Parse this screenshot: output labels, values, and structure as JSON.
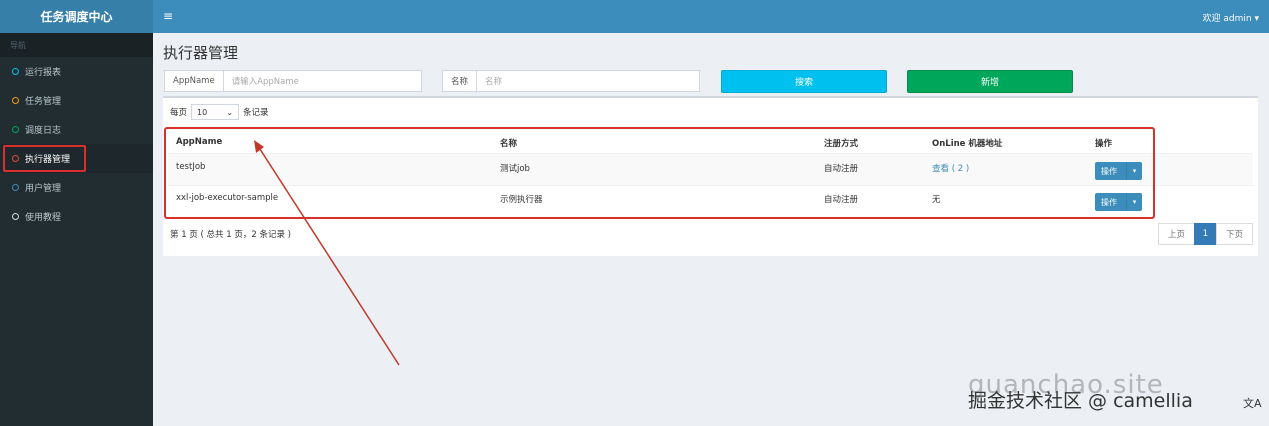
{
  "app": {
    "title": "任务调度中心"
  },
  "header": {
    "menu_toggle": "≡",
    "user_text": "欢迎 admin"
  },
  "sidebar": {
    "section_label": "导航",
    "items": [
      {
        "label": "运行报表",
        "color": "#00c0ef"
      },
      {
        "label": "任务管理",
        "color": "#f39c12"
      },
      {
        "label": "调度日志",
        "color": "#00a65a"
      },
      {
        "label": "执行器管理",
        "color": "#dd4b39"
      },
      {
        "label": "用户管理",
        "color": "#3c8dbc"
      },
      {
        "label": "使用教程",
        "color": "#d2d6de"
      }
    ]
  },
  "page": {
    "title": "执行器管理"
  },
  "filters": {
    "appname_label": "AppName",
    "appname_placeholder": "请输入AppName",
    "title_label": "名称",
    "title_placeholder": "名称"
  },
  "buttons": {
    "search": "搜索",
    "add": "新增",
    "search_color": "#00c0ef",
    "add_color": "#00a65a"
  },
  "pagesize": {
    "prefix": "每页",
    "value": "10",
    "suffix": "条记录"
  },
  "table": {
    "headers": [
      "AppName",
      "名称",
      "注册方式",
      "OnLine 机器地址",
      "操作"
    ],
    "rows": [
      {
        "appname": "testJob",
        "title": "测试job",
        "reg_type": "自动注册",
        "online": "查看 ( 2 )",
        "action": "操作"
      },
      {
        "appname": "xxl-job-executor-sample",
        "title": "示例执行器",
        "reg_type": "自动注册",
        "online": "无",
        "action": "操作"
      }
    ]
  },
  "footer": {
    "summary": "第 1 页 ( 总共 1 页，2 条记录 )",
    "pager": {
      "prev": "上页",
      "current": "1",
      "next": "下页"
    }
  },
  "watermark": {
    "text_back": "guanchao.site",
    "text_front": "掘金技术社区 @ camellia"
  }
}
